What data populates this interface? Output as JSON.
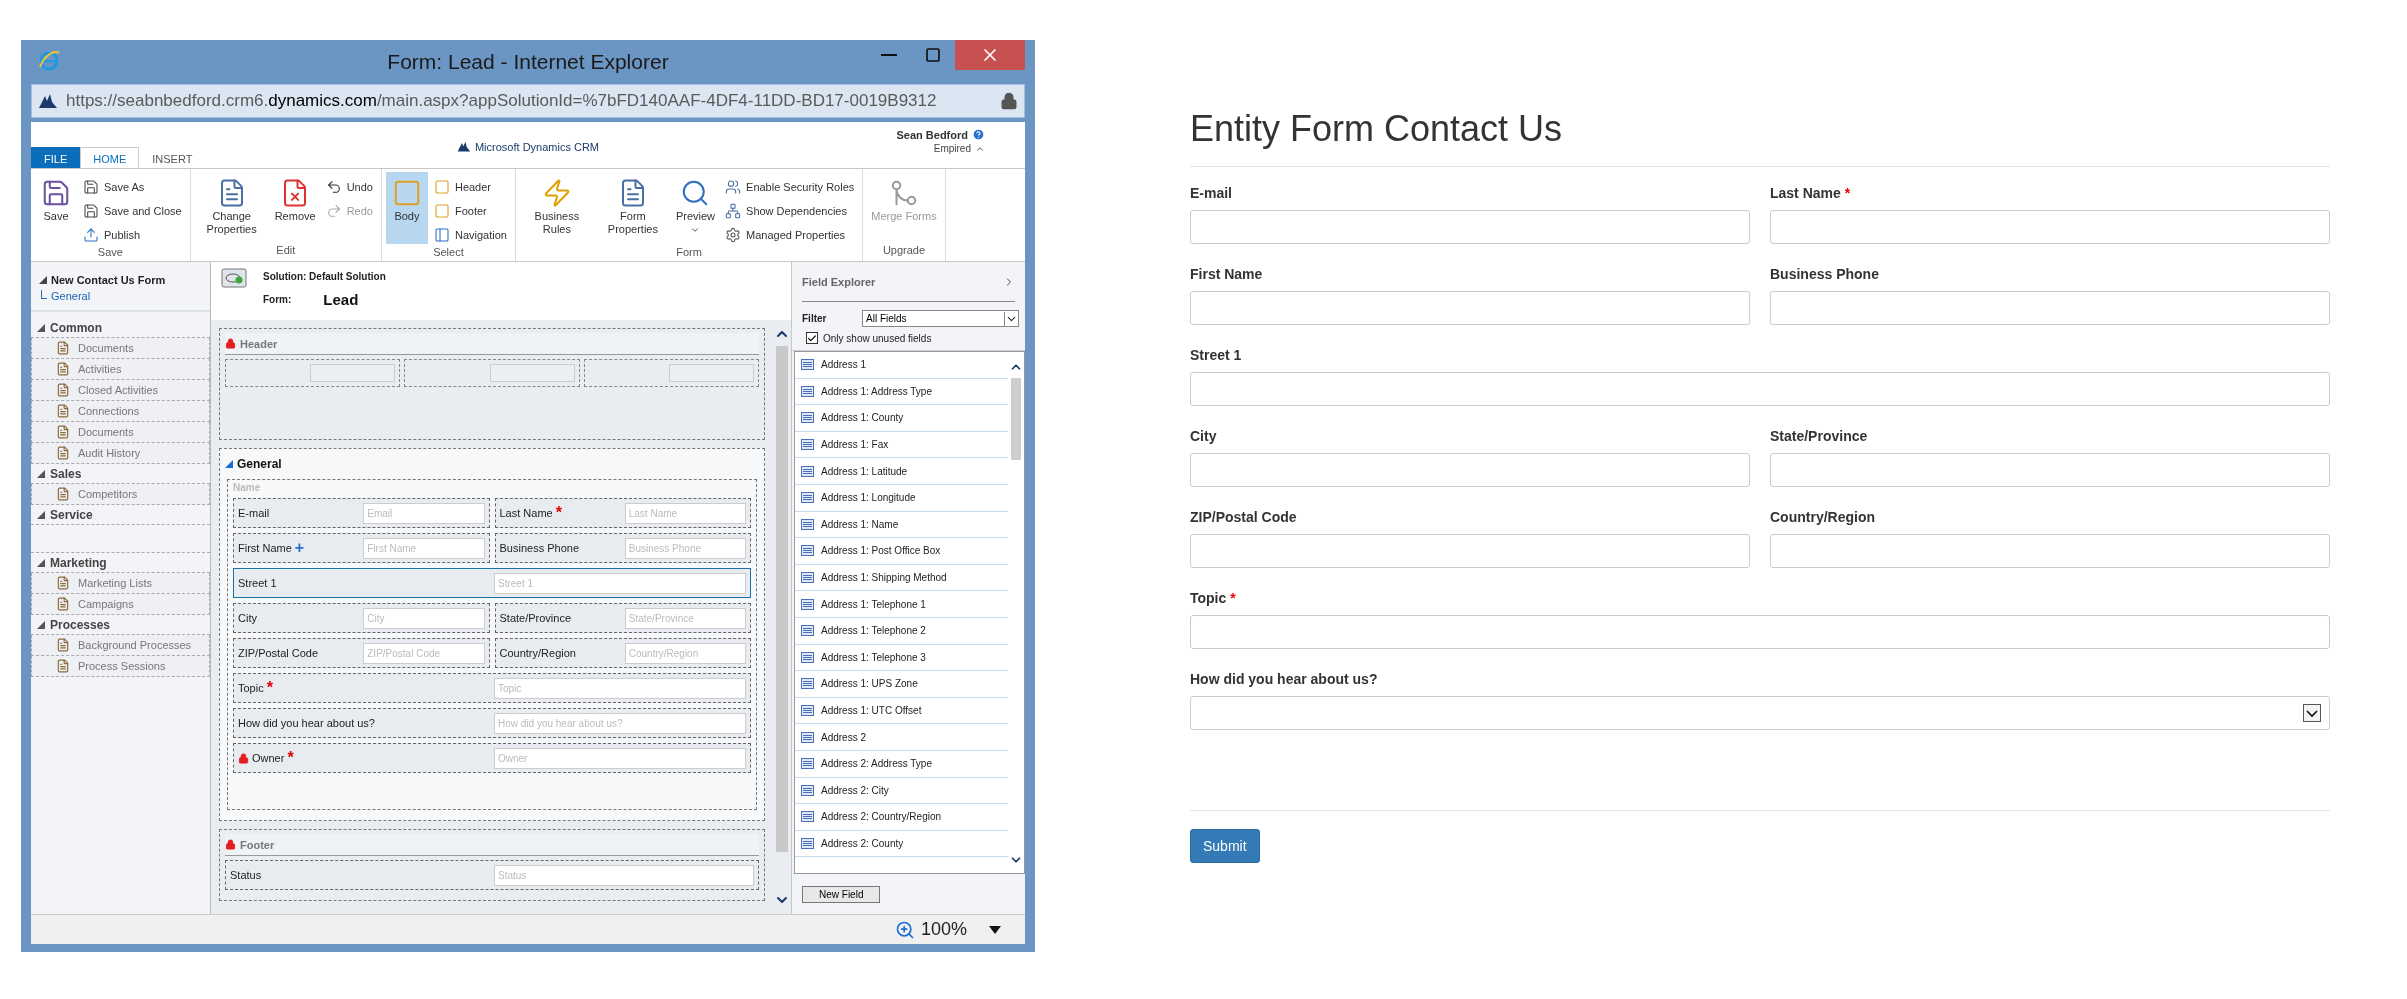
{
  "window": {
    "title": "Form: Lead - Internet Explorer",
    "url": [
      {
        "text": "https://seabnbedford.crm6.",
        "highlighted": false
      },
      {
        "text": "dynamics.com",
        "highlighted": true
      },
      {
        "text": "/main.aspx?appSolutionId=%7bFD140AAF-4DF4-11DD-BD17-0019B9312",
        "highlighted": false
      }
    ]
  },
  "crm": {
    "brand": "Microsoft Dynamics CRM",
    "user": "Sean Bedford",
    "organization": "Empired",
    "tabs": [
      {
        "label": "FILE",
        "kind": "file",
        "selected": false
      },
      {
        "label": "HOME",
        "kind": "tab",
        "selected": true
      },
      {
        "label": "INSERT",
        "kind": "tab",
        "selected": false
      }
    ],
    "ribbon": [
      {
        "name": "Save",
        "items": [
          {
            "label": "Save",
            "kind": "large",
            "selected": false,
            "disabled": false
          },
          {
            "label": "Save As",
            "kind": "small",
            "selected": false,
            "disabled": false
          },
          {
            "label": "Save and Close",
            "kind": "small",
            "selected": false,
            "disabled": false
          },
          {
            "label": "Publish",
            "kind": "small",
            "selected": false,
            "disabled": false
          }
        ]
      },
      {
        "name": "Edit",
        "items": [
          {
            "label": "Change Properties",
            "kind": "large",
            "selected": false,
            "disabled": false
          },
          {
            "label": "Remove",
            "kind": "large",
            "selected": false,
            "disabled": false
          },
          {
            "label": "Undo",
            "kind": "small",
            "selected": false,
            "disabled": false
          },
          {
            "label": "Redo",
            "kind": "small",
            "selected": false,
            "disabled": true
          }
        ]
      },
      {
        "name": "Select",
        "items": [
          {
            "label": "Body",
            "kind": "large",
            "selected": true,
            "disabled": false
          },
          {
            "label": "Header",
            "kind": "small",
            "selected": false,
            "disabled": false
          },
          {
            "label": "Footer",
            "kind": "small",
            "selected": false,
            "disabled": false
          },
          {
            "label": "Navigation",
            "kind": "small",
            "selected": false,
            "disabled": false
          }
        ]
      },
      {
        "name": "Form",
        "items": [
          {
            "label": "Business Rules",
            "kind": "large",
            "selected": false,
            "disabled": false
          },
          {
            "label": "Form Properties",
            "kind": "large",
            "selected": false,
            "disabled": false
          },
          {
            "label": "Preview",
            "kind": "large",
            "selected": false,
            "disabled": false,
            "has_menu": true
          },
          {
            "label": "Enable Security Roles",
            "kind": "small",
            "selected": false,
            "disabled": false
          },
          {
            "label": "Show Dependencies",
            "kind": "small",
            "selected": false,
            "disabled": false
          },
          {
            "label": "Managed Properties",
            "kind": "small",
            "selected": false,
            "disabled": false
          }
        ]
      },
      {
        "name": "Upgrade",
        "items": [
          {
            "label": "Merge Forms",
            "kind": "large",
            "selected": false,
            "disabled": true
          }
        ]
      }
    ]
  },
  "navigation": {
    "title": "New Contact Us Form",
    "link": "General",
    "groups": [
      {
        "title": "Common",
        "expanded": true,
        "items": [
          "Documents",
          "Activities",
          "Closed Activities",
          "Connections",
          "Documents",
          "Audit History"
        ]
      },
      {
        "title": "Sales",
        "expanded": true,
        "items": [
          "Competitors"
        ]
      },
      {
        "title": "Service",
        "expanded": true
      },
      {
        "title": "Marketing",
        "expanded": true,
        "items": [
          "Marketing Lists",
          "Campaigns"
        ]
      },
      {
        "title": "Processes",
        "expanded": true,
        "items": [
          "Background Processes",
          "Process Sessions"
        ]
      }
    ]
  },
  "form_editor": {
    "solution": "Solution: Default Solution",
    "form_label": "Form:",
    "form_name": "Lead",
    "header": {
      "title": "Header",
      "locked": true
    },
    "general": {
      "title": "General",
      "expanded": true,
      "subsection": "Name",
      "rows": [
        [
          {
            "label": "E-mail",
            "placeholder": "Email",
            "selected": false,
            "locked": false
          },
          {
            "label": "Last Name",
            "placeholder": "Last Name",
            "color": "#e00000",
            "mark": "*",
            "selected": false,
            "locked": false
          }
        ],
        [
          {
            "label": "First Name",
            "placeholder": "First Name",
            "color": "#2a6fd0",
            "mark": "+",
            "selected": false,
            "locked": false
          },
          {
            "label": "Business Phone",
            "placeholder": "Business Phone",
            "selected": false,
            "locked": false
          }
        ],
        [
          {
            "label": "Street 1",
            "placeholder": "Street 1",
            "selected": true,
            "locked": false
          }
        ],
        [
          {
            "label": "City",
            "placeholder": "City",
            "selected": false,
            "locked": false
          },
          {
            "label": "State/Province",
            "placeholder": "State/Province",
            "selected": false,
            "locked": false
          }
        ],
        [
          {
            "label": "ZIP/Postal Code",
            "placeholder": "ZIP/Postal Code",
            "selected": false,
            "locked": false
          },
          {
            "label": "Country/Region",
            "placeholder": "Country/Region",
            "selected": false,
            "locked": false
          }
        ],
        [
          {
            "label": "Topic",
            "placeholder": "Topic",
            "color": "#e00000",
            "mark": "*",
            "selected": false,
            "locked": false
          }
        ],
        [
          {
            "label": "How did you hear about us?",
            "placeholder": "How did you hear about us?",
            "selected": false,
            "locked": false
          }
        ],
        [
          {
            "label": "Owner",
            "placeholder": "Owner",
            "color": "#e00000",
            "mark": "*",
            "selected": false,
            "locked": true
          }
        ]
      ]
    },
    "footer": {
      "title": "Footer",
      "locked": true,
      "rows": [
        [
          {
            "label": "Status",
            "placeholder": "Status",
            "selected": false,
            "locked": false
          }
        ]
      ]
    }
  },
  "field_explorer": {
    "title": "Field Explorer",
    "filter_label": "Filter",
    "filter_value": "All Fields",
    "only_unused": {
      "label": "Only show unused fields",
      "checked": true
    },
    "fields": [
      "Address 1",
      "Address 1: Address Type",
      "Address 1: County",
      "Address 1: Fax",
      "Address 1: Latitude",
      "Address 1: Longitude",
      "Address 1: Name",
      "Address 1: Post Office Box",
      "Address 1: Shipping Method",
      "Address 1: Telephone 1",
      "Address 1: Telephone 2",
      "Address 1: Telephone 3",
      "Address 1: UPS Zone",
      "Address 1: UTC Offset",
      "Address 2",
      "Address 2: Address Type",
      "Address 2: City",
      "Address 2: Country/Region",
      "Address 2: County"
    ],
    "button": "New Field"
  },
  "status_bar": {
    "zoom": "100%"
  },
  "entity_form": {
    "title": "Entity Form Contact Us",
    "rows": [
      [
        {
          "label": "E-mail",
          "kind": "text"
        },
        {
          "label": "Last Name",
          "kind": "text",
          "mark": "*"
        }
      ],
      [
        {
          "label": "First Name",
          "kind": "text"
        },
        {
          "label": "Business Phone",
          "kind": "text"
        }
      ],
      [
        {
          "label": "Street 1",
          "kind": "text"
        }
      ],
      [
        {
          "label": "City",
          "kind": "text"
        },
        {
          "label": "State/Province",
          "kind": "text"
        }
      ],
      [
        {
          "label": "ZIP/Postal Code",
          "kind": "text"
        },
        {
          "label": "Country/Region",
          "kind": "text"
        }
      ],
      [
        {
          "label": "Topic",
          "kind": "text",
          "mark": "*"
        }
      ],
      [
        {
          "label": "How did you hear about us?",
          "kind": "select"
        }
      ]
    ],
    "submit": "Submit"
  }
}
